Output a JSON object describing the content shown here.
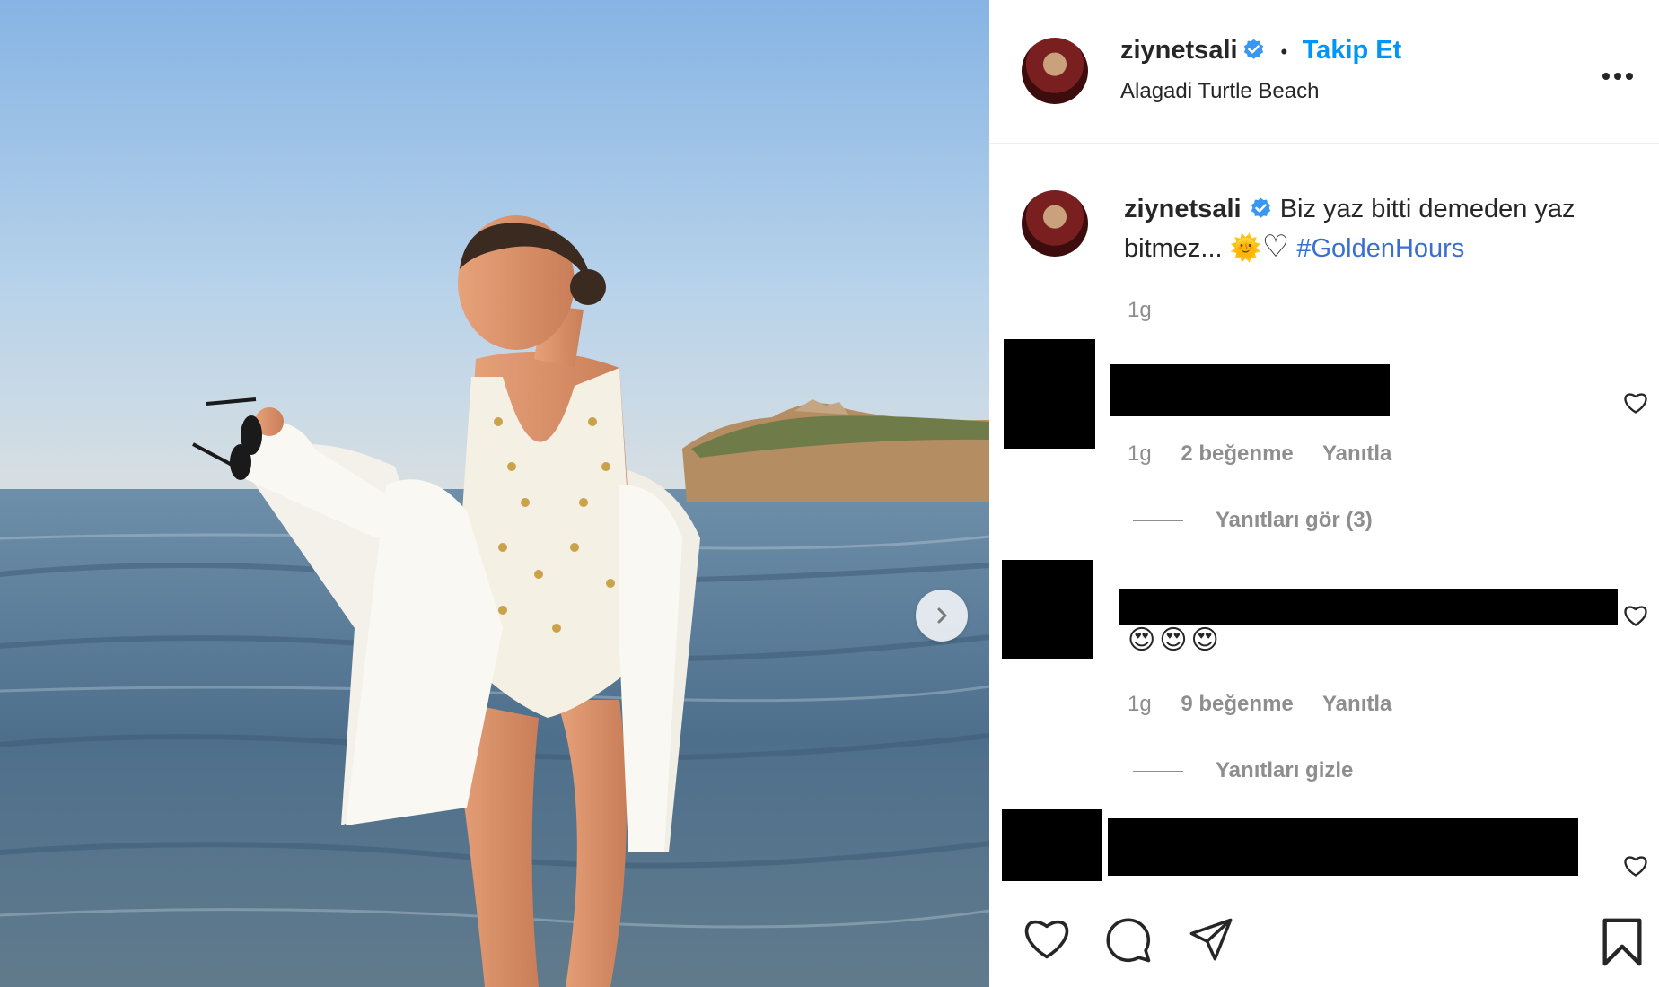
{
  "post": {
    "username": "ziynetsali",
    "follow_label": "Takip Et",
    "location": "Alagadi Turtle Beach",
    "caption_user": "ziynetsali",
    "caption_text": "Biz yaz bitti demeden yaz bitmez... ",
    "caption_emoji_sun": "🌞",
    "caption_emoji_heart": "♡",
    "caption_hashtag": "#GoldenHours",
    "caption_time": "1g",
    "more_label": "•••"
  },
  "comments": [
    {
      "time": "1g",
      "likes": "2 beğenme",
      "reply": "Yanıtla",
      "replies_toggle": "Yanıtları gör (3)"
    },
    {
      "time": "1g",
      "likes": "9 beğenme",
      "reply": "Yanıtla",
      "replies_toggle": "Yanıtları gizle",
      "emojis": "😍😍😍"
    }
  ],
  "colors": {
    "link": "#0095f6",
    "hashtag": "#3a6fd0",
    "meta": "#8e8e8e",
    "text": "#262626"
  },
  "icons": {
    "like": "heart-icon",
    "comment": "comment-icon",
    "share": "share-icon",
    "save": "bookmark-icon",
    "next": "chevron-right-icon",
    "verified": "verified-badge-icon"
  }
}
